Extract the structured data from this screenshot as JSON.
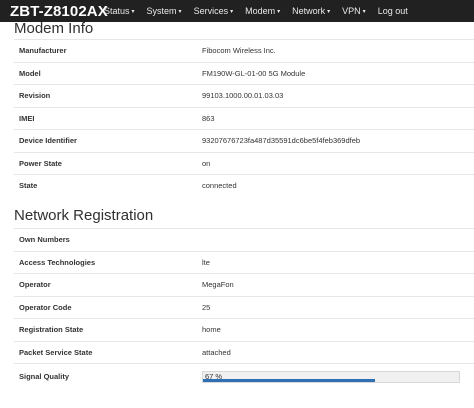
{
  "navbar": {
    "brand": "ZBT-Z8102AX",
    "items": [
      {
        "label": "Status",
        "caret": "▾"
      },
      {
        "label": "System",
        "caret": "▾"
      },
      {
        "label": "Services",
        "caret": "▾"
      },
      {
        "label": "Modem",
        "caret": "▾"
      },
      {
        "label": "Network",
        "caret": "▾"
      },
      {
        "label": "VPN",
        "caret": "▾"
      },
      {
        "label": "Log out",
        "caret": ""
      }
    ]
  },
  "modem_info": {
    "title": "Modem Info",
    "rows": [
      {
        "key": "Manufacturer",
        "value": "Fibocom Wireless Inc."
      },
      {
        "key": "Model",
        "value": "FM190W-GL-01-00 5G Module"
      },
      {
        "key": "Revision",
        "value": "99103.1000.00.01.03.03"
      },
      {
        "key": "IMEI",
        "value": "863"
      },
      {
        "key": "Device Identifier",
        "value": "93207676723fa487d35591dc6be5f4feb369dfeb"
      },
      {
        "key": "Power State",
        "value": "on"
      },
      {
        "key": "State",
        "value": "connected"
      }
    ]
  },
  "network_registration": {
    "title": "Network Registration",
    "rows": [
      {
        "key": "Own Numbers",
        "value": ""
      },
      {
        "key": "Access Technologies",
        "value": "lte"
      },
      {
        "key": "Operator",
        "value": "MegaFon"
      },
      {
        "key": "Operator Code",
        "value": "25"
      },
      {
        "key": "Registration State",
        "value": "home"
      },
      {
        "key": "Packet Service State",
        "value": "attached"
      }
    ],
    "signal": {
      "key": "Signal Quality",
      "label": "67 %",
      "percent": 67
    }
  },
  "colors": {
    "navbar": "#212121",
    "progress_bar": "#2f6fb3"
  }
}
